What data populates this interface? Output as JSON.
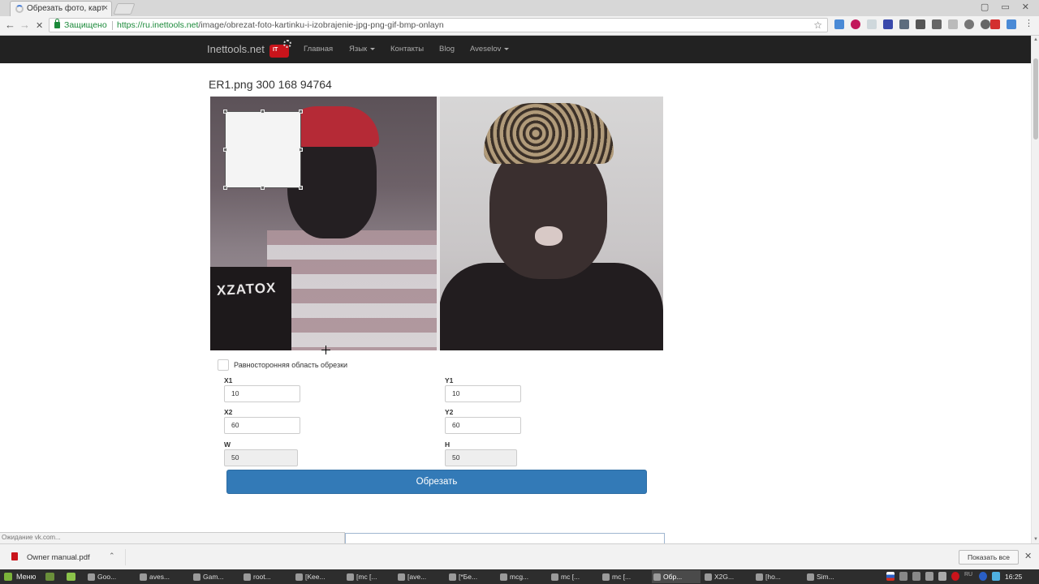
{
  "browser": {
    "tab_title": "Обрезать фото, карт",
    "tab_close": "×",
    "window_controls": "▢ ▭ ✕",
    "secure_label": "Защищено",
    "url_host": "https://ru.inettools.net",
    "url_path": "/image/obrezat-foto-kartinku-i-izobrajenie-jpg-png-gif-bmp-onlayn",
    "back_icon": "←",
    "forward_icon": "→",
    "stop_icon": "✕",
    "star_icon": "☆"
  },
  "navbar": {
    "brand": "Inettools.net",
    "logo_text": "IT",
    "links": [
      "Главная",
      "Язык",
      "Контакты",
      "Blog",
      "Aveselov"
    ]
  },
  "main": {
    "file_title": "ER1.png 300 168 94764",
    "image_caption": "XZATOX",
    "square_label": "Равносторонняя область обрезки",
    "fields": {
      "x1": {
        "label": "X1",
        "value": "10"
      },
      "y1": {
        "label": "Y1",
        "value": "10"
      },
      "x2": {
        "label": "X2",
        "value": "60"
      },
      "y2": {
        "label": "Y2",
        "value": "60"
      },
      "w": {
        "label": "W",
        "value": "50"
      },
      "h": {
        "label": "H",
        "value": "50"
      }
    },
    "crop_button": "Обрезать"
  },
  "status": {
    "text": "Ожидание vk.com..."
  },
  "downloads": {
    "file_name": "Owner manual.pdf",
    "chevron": "⌃",
    "show_all": "Показать все",
    "close": "✕"
  },
  "taskbar": {
    "menu": "Меню",
    "tasks": [
      "Goo...",
      "aves...",
      "Gam...",
      "root...",
      "[Kee...",
      "[mc [...",
      "[ave...",
      "[*Бе...",
      "mcg...",
      "mc [...",
      "mc [...",
      "Обр...",
      "X2G...",
      "[ho...",
      "Sim..."
    ],
    "lang": "RU",
    "clock": "16:25"
  }
}
